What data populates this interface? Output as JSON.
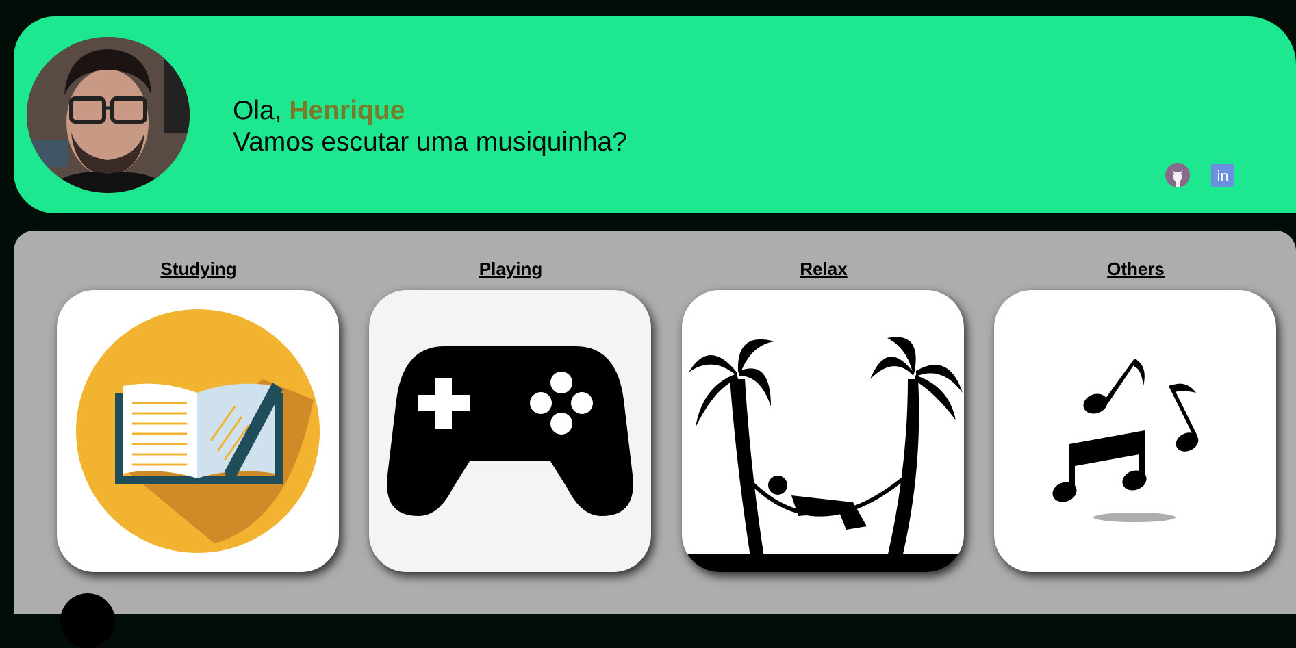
{
  "header": {
    "greeting_prefix": "Ola, ",
    "user_name": "Henrique",
    "subtitle": "Vamos escutar uma musiquinha?"
  },
  "social": [
    {
      "icon": "github-icon"
    },
    {
      "icon": "linkedin-icon",
      "label": "in"
    }
  ],
  "categories": [
    {
      "label": "Studying",
      "icon": "open-book-pen-icon"
    },
    {
      "label": "Playing",
      "icon": "gamepad-icon"
    },
    {
      "label": "Relax",
      "icon": "hammock-palm-trees-icon"
    },
    {
      "label": "Others",
      "icon": "music-notes-icon"
    }
  ],
  "colors": {
    "page_bg": "#030d08",
    "header_bg": "#1de88f",
    "panel_bg": "#adadad",
    "name_color": "#7c7a2a"
  }
}
